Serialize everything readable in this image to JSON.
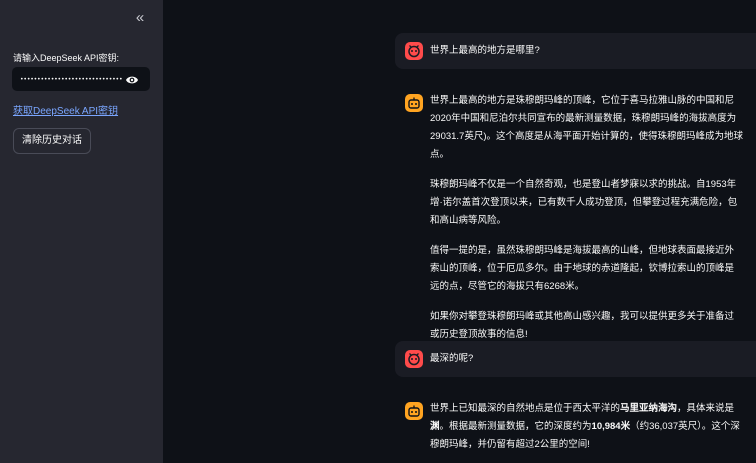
{
  "sidebar": {
    "collapse_icon": "«",
    "api_key_label": "请输入DeepSeek API密钥:",
    "api_key_value": "••••••••••••••••••••••••••••••••••••",
    "link_text": "获取DeepSeek API密钥",
    "clear_button": "清除历史对话"
  },
  "chat": {
    "q1": "世界上最高的地方是哪里?",
    "a1": [
      "世界上最高的地方是珠穆朗玛峰的顶峰，它位于喜马拉雅山脉的中国和尼",
      "2020年中国和尼泊尔共同宣布的最新测量数据，珠穆朗玛峰的海拔高度为",
      "29031.7英尺)。这个高度是从海平面开始计算的，使得珠穆朗玛峰成为地球",
      "点。"
    ],
    "a2": [
      "珠穆朗玛峰不仅是一个自然奇观，也是登山者梦寐以求的挑战。自1953年",
      "增·诺尔盖首次登顶以来，已有数千人成功登顶，但攀登过程充满危险，包",
      "和高山病等风险。"
    ],
    "a3": [
      "值得一提的是，虽然珠穆朗玛峰是海拔最高的山峰，但地球表面最接近外",
      "索山的顶峰，位于厄瓜多尔。由于地球的赤道隆起，钦博拉索山的顶峰是",
      "远的点，尽管它的海拔只有6268米。"
    ],
    "a4": [
      "如果你对攀登珠穆朗玛峰或其他高山感兴趣，我可以提供更多关于准备过",
      "或历史登顶故事的信息!"
    ],
    "q2": "最深的呢?",
    "b1_pre": "世界上已知最深的自然地点是位于西太平洋的",
    "b1_bold": "马里亚纳海沟",
    "b1_post": "，具体来说是",
    "b2_bold1": "渊",
    "b2_mid": "。根据最新测量数据，它的深度约为",
    "b2_bold2": "10,984米",
    "b2_post": "（约36,037英尺）。这个深",
    "b3": "穆朗玛峰，并仍留有超过2公里的空间!"
  },
  "icons": {
    "eye": "eye-icon",
    "user_avatar": "user-avatar-icon",
    "assistant_avatar": "assistant-avatar-icon"
  },
  "colors": {
    "background": "#0e1117",
    "sidebar": "#262730",
    "user_avatar": "#ff4b4b",
    "assistant_avatar": "#ffa421",
    "link": "#7aa6ff"
  }
}
